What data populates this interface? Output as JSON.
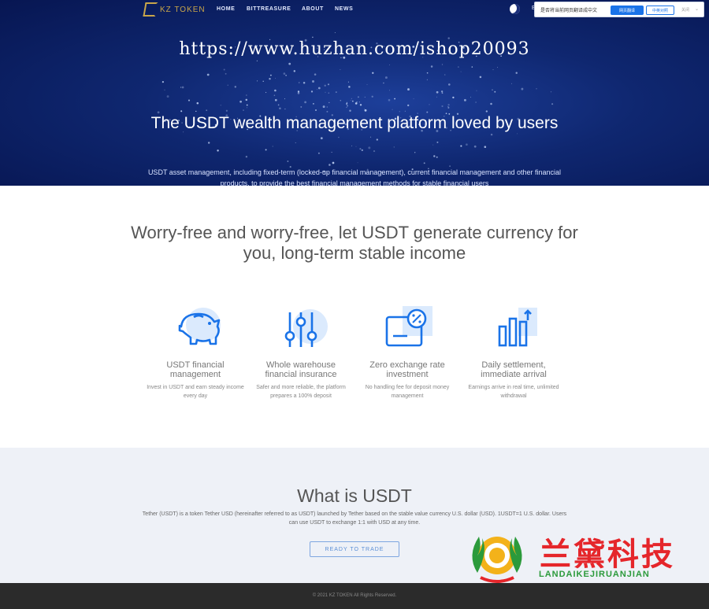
{
  "header": {
    "logo_text": "KZ TOKEN",
    "nav": [
      "HOME",
      "BITTREASURE",
      "ABOUT",
      "NEWS"
    ],
    "extra": "E"
  },
  "translate_popup": {
    "message": "是否将当前网页翻译成中文",
    "translate_label": "网页翻译",
    "always_label": "中英对照",
    "close_label": "关闭"
  },
  "hero": {
    "watermark_url": "https://www.huzhan.com/ishop20093",
    "title": "The USDT wealth management platform loved by users",
    "subtitle": "USDT asset management, including fixed-term (locked-up financial management), current financial management and other financial products, to provide the best financial management methods for stable financial users"
  },
  "features": {
    "heading": "Worry-free and worry-free, let USDT generate currency for you, long-term stable income",
    "items": [
      {
        "icon": "piggy-bank-icon",
        "title": "USDT financial management",
        "desc": "Invest in USDT and earn steady income every day"
      },
      {
        "icon": "sliders-icon",
        "title": "Whole warehouse financial insurance",
        "desc": "Safer and more reliable, the platform prepares a 100% deposit"
      },
      {
        "icon": "percent-card-icon",
        "title": "Zero exchange rate investment",
        "desc": "No handling fee for deposit money management"
      },
      {
        "icon": "bar-growth-icon",
        "title": "Daily settlement, immediate arrival",
        "desc": "Earnings arrive in real time, unlimited withdrawal"
      }
    ]
  },
  "what": {
    "title": "What is USDT",
    "body": "Tether (USDT) is a token Tether USD (hereinafter referred to as USDT) launched by Tether based on the stable value currency U.S. dollar (USD). 1USDT=1 U.S. dollar. Users can use USDT to exchange 1:1 with USD at any time.",
    "button": "READY TO TRADE"
  },
  "footer": {
    "copyright": "© 2021 KZ TOKEN All Rights Reserved."
  },
  "brand_watermark": {
    "cn": "兰黛科技",
    "en": "LANDAIKEJIRUANJIAN"
  },
  "colors": {
    "hero_bg": "#0f2770",
    "icon_blue": "#1a73e8",
    "brand_red": "#e5262b",
    "brand_green": "#2b9a3b"
  }
}
